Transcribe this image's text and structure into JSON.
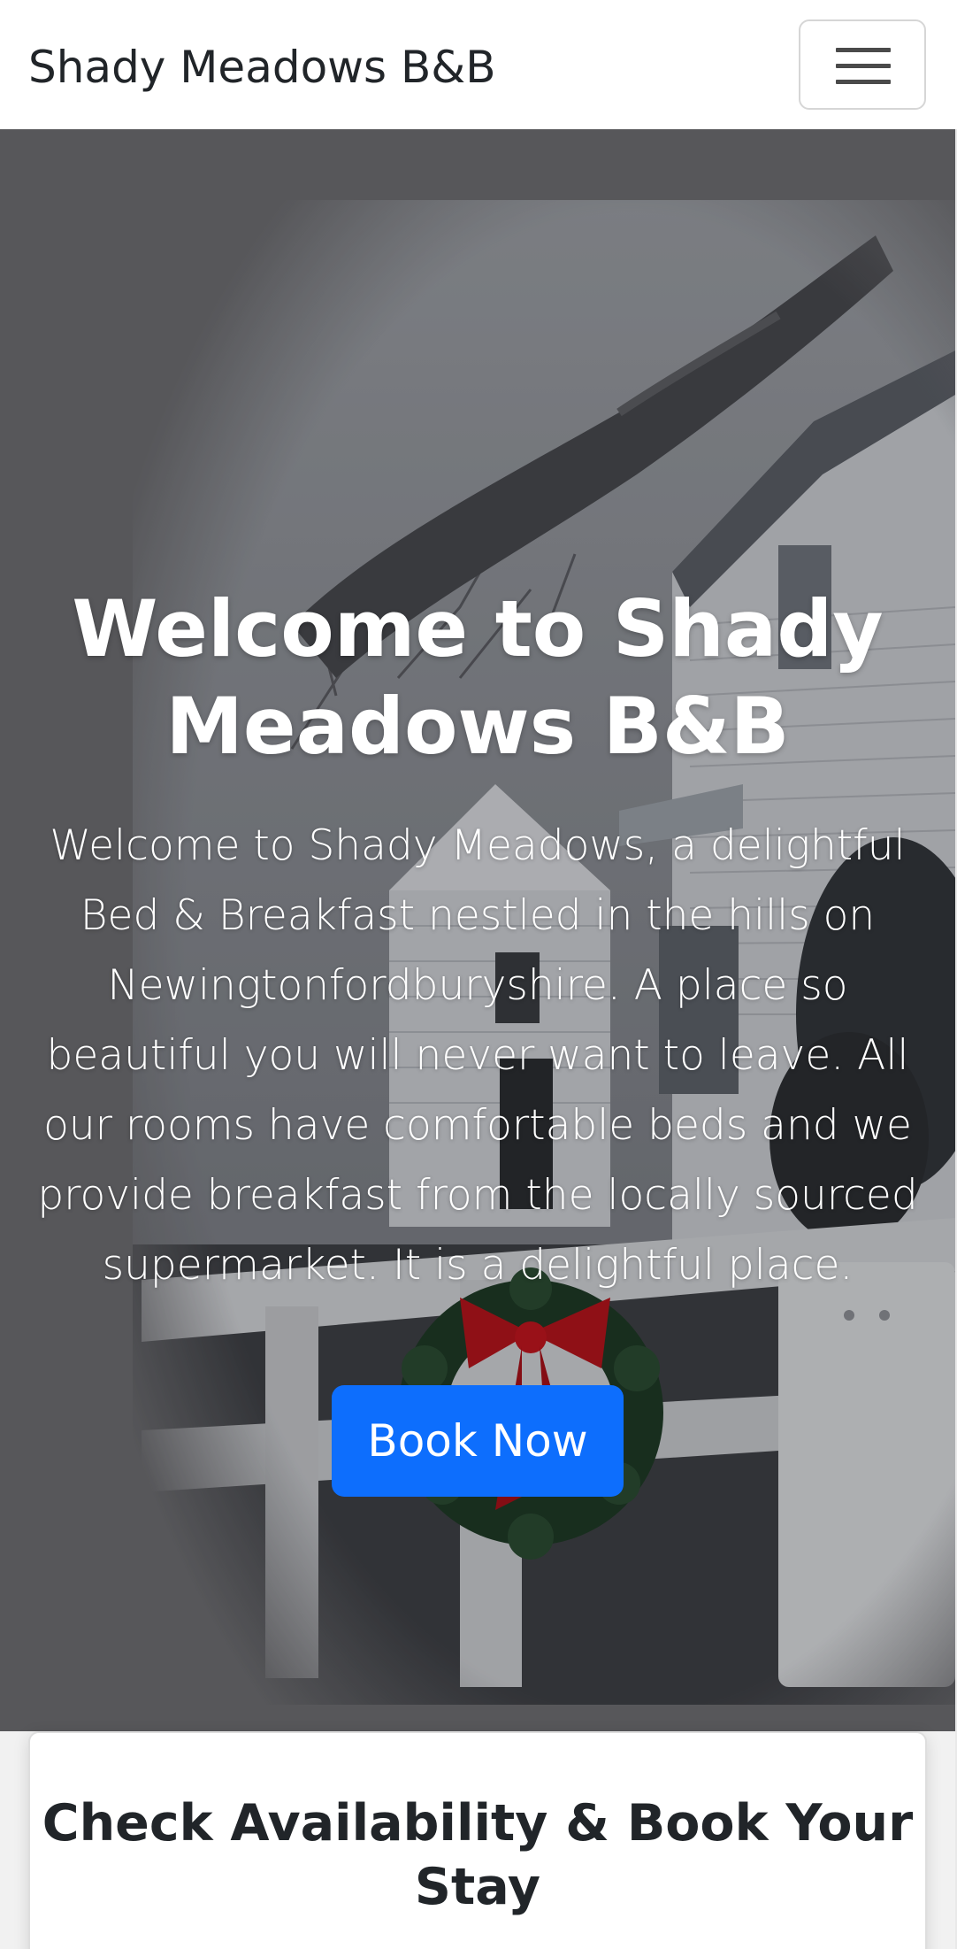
{
  "navbar": {
    "brand": "Shady Meadows B&B",
    "toggler_icon": "hamburger-menu-icon"
  },
  "hero": {
    "title": "Welcome to Shady Meadows B&B",
    "lead": "Welcome to Shady Meadows, a delightful Bed & Breakfast nestled in the hills on Newingtonfordburyshire. A place so beautiful you will never want to leave. All our rooms have comfortable beds and we provide breakfast from the locally sourced supermarket. It is a delightful place.",
    "book_button": "Book Now"
  },
  "booking_card": {
    "title": "Check Availability & Book Your Stay"
  },
  "colors": {
    "primary": "#0d6efd",
    "text_dark": "#212529",
    "hero_overlay": "#6a6a6e"
  }
}
